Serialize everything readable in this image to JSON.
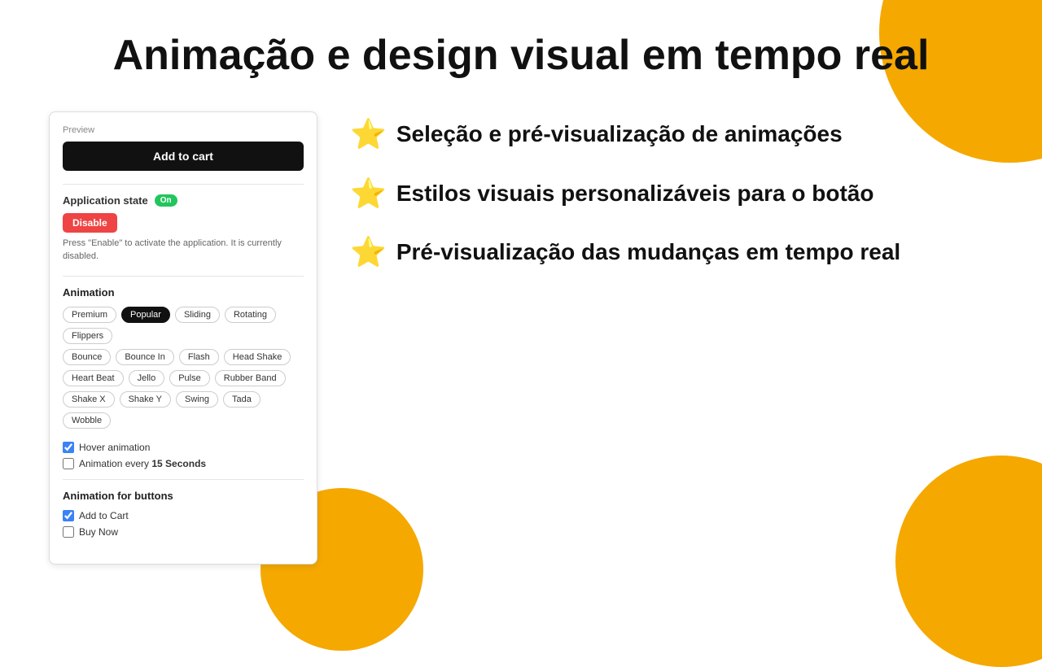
{
  "page": {
    "title": "Animação e design visual em tempo real",
    "decorations": {
      "circle1": "top-right",
      "circle2": "bottom-right",
      "circle3": "bottom-left"
    }
  },
  "panel": {
    "preview_label": "Preview",
    "add_to_cart_btn": "Add to cart",
    "app_state_label": "Application state",
    "app_state_badge": "On",
    "disable_btn": "Disable",
    "hint_text": "Press \"Enable\" to activate the application. It is currently disabled.",
    "animation_section_title": "Animation",
    "animation_tabs": [
      {
        "label": "Premium",
        "active": false
      },
      {
        "label": "Popular",
        "active": true
      },
      {
        "label": "Sliding",
        "active": false
      },
      {
        "label": "Rotating",
        "active": false
      },
      {
        "label": "Flippers",
        "active": false
      }
    ],
    "animation_tags_row1": [
      "Bounce",
      "Bounce In",
      "Flash",
      "Head Shake"
    ],
    "animation_tags_row2": [
      "Heart Beat",
      "Jello",
      "Pulse",
      "Rubber Band"
    ],
    "animation_tags_row3": [
      "Shake X",
      "Shake Y",
      "Swing",
      "Tada",
      "Wobble"
    ],
    "hover_animation_label": "Hover animation",
    "hover_animation_checked": true,
    "animation_every_label": "Animation every",
    "animation_every_value": "15 Seconds",
    "animation_every_checked": false,
    "animation_for_buttons_title": "Animation for buttons",
    "add_to_cart_check_label": "Add to Cart",
    "add_to_cart_check_checked": true,
    "buy_now_check_label": "Buy Now",
    "buy_now_check_checked": false
  },
  "features": [
    {
      "star": "⭐",
      "text": "Seleção e pré-visualização de animações"
    },
    {
      "star": "⭐",
      "text": "Estilos visuais personalizáveis para o botão"
    },
    {
      "star": "⭐",
      "text": "Pré-visualização das mudanças em tempo real"
    }
  ]
}
